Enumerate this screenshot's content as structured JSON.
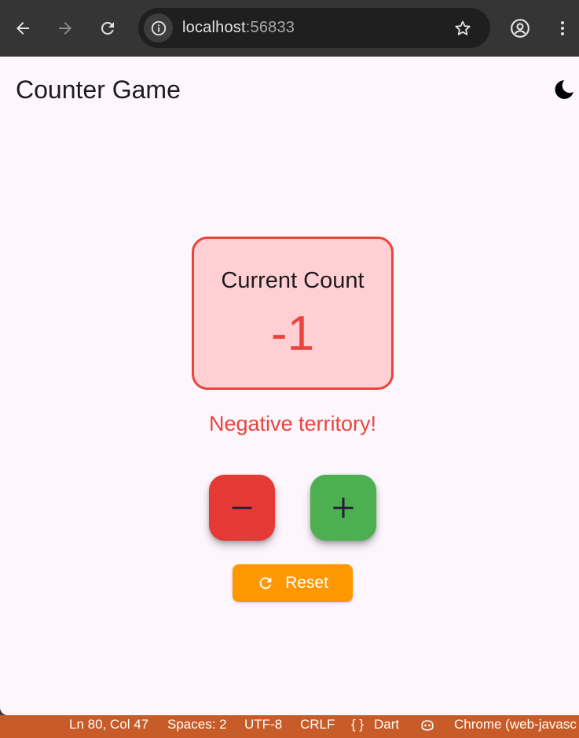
{
  "browser": {
    "url_host": "localhost",
    "url_port": ":56833"
  },
  "app": {
    "title": "Counter Game",
    "theme_toggle_icon": "moon-icon",
    "counter": {
      "label": "Current Count",
      "value": "-1"
    },
    "status_message": "Negative territory!",
    "decrement_icon": "minus-icon",
    "increment_icon": "plus-icon",
    "reset_label": "Reset",
    "reset_icon": "refresh-icon"
  },
  "status_bar": {
    "position": "Ln 80, Col 47",
    "spaces": "Spaces: 2",
    "encoding": "UTF-8",
    "line_ending": "CRLF",
    "language_braces": "{ }",
    "language": "Dart",
    "device": "Chrome (web-javasc"
  },
  "colors": {
    "app_background": "#fdf6fd",
    "card_background": "#ffcfd3",
    "negative_accent": "#e8453c",
    "decrement_button": "#e53935",
    "increment_button": "#4caf50",
    "reset_button": "#ff9800",
    "status_bar": "#c75c28",
    "browser_toolbar": "#353535"
  }
}
